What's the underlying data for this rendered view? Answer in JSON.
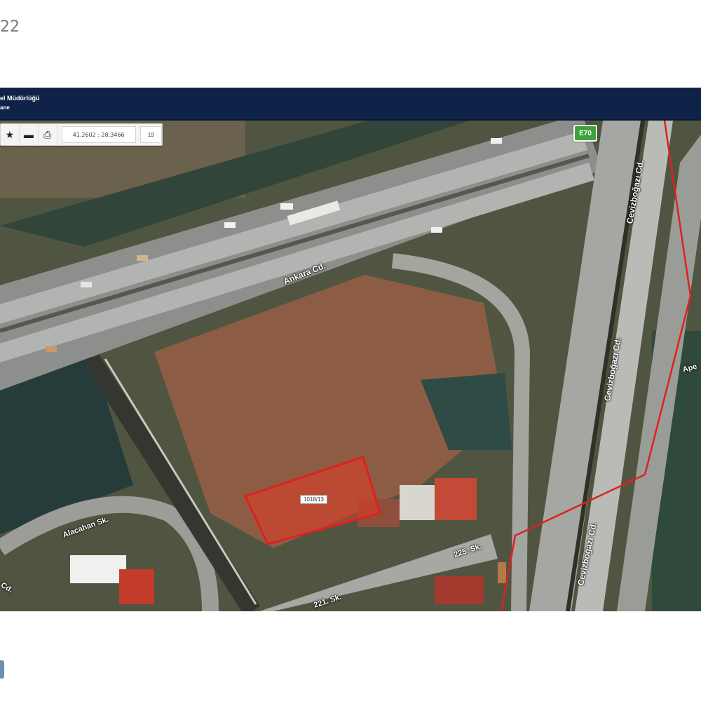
{
  "page": {
    "corner_text": "22"
  },
  "header": {
    "org_line1": "el Müdürlüğü",
    "org_line2": "ane"
  },
  "toolbar": {
    "coordinates": "41.2602 : 28.3466",
    "zoom": "19",
    "icons": [
      "star-icon",
      "minus-icon",
      "print-icon"
    ]
  },
  "map": {
    "route_shield": "E70",
    "streets": {
      "ankara": "Ankara Cd.",
      "cevizbogazi_top": "Cevizboğazı Cd.",
      "cevizbogazi_mid": "Cevizboğazı Cd.",
      "cevizbogazi_bottom": "Cevizboğazı Cd.",
      "alacahan": "Alacahan Sk.",
      "left_bottom": "Cd.",
      "s221": "221. Sk.",
      "s225": "225. Sk.",
      "right_cut": "Ape"
    },
    "parcel_label": "1018/13",
    "colors": {
      "parcel": "#e02020",
      "header": "#0e2347",
      "shield": "#3da33d"
    }
  }
}
